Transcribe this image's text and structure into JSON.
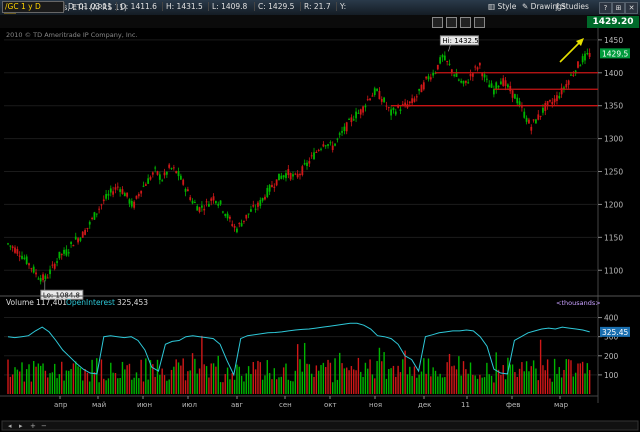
{
  "window": {
    "title": "Gold Futures, ETH (APRS 11)",
    "buttons": {
      "help": "?",
      "pin": "⊞",
      "close": "✕"
    }
  },
  "quote": {
    "symbol": "/GC 1 y D",
    "date": "D: 01.03.11",
    "open": "O: 1411.6",
    "high": "H: 1431.5",
    "low": "L: 1409.8",
    "close": "C: 1429.5",
    "range": "R: 21.7",
    "y": "Y:",
    "last": "1429.20"
  },
  "toolbar": {
    "style": "Style",
    "drawings": "Drawings",
    "studies": "Studies"
  },
  "copyright": "2010 © TD Ameritrade IP Company, Inc.",
  "colors": {
    "up": "#00b400",
    "down": "#d01818",
    "oi": "#2ec8d8",
    "resistance": "#c81414",
    "arrow": "#e6e000",
    "price_tag": "#009a3c",
    "oi_tag": "#1a6fb0"
  },
  "chart_data": {
    "type": "candlestick",
    "price": {
      "yticks": [
        1100,
        1150,
        1200,
        1250,
        1300,
        1350,
        1400,
        1450
      ],
      "ylim": [
        1070,
        1465
      ],
      "last_tag": "1429.5",
      "high_label": "Hi: 1432.5",
      "low_label": "Lo: 1084.8",
      "resistance_levels": [
        1400,
        1375,
        1350
      ],
      "path": [
        [
          0,
          1140
        ],
        [
          6,
          1128
        ],
        [
          12,
          1108
        ],
        [
          16,
          1092
        ],
        [
          20,
          1086
        ],
        [
          24,
          1102
        ],
        [
          28,
          1122
        ],
        [
          32,
          1128
        ],
        [
          36,
          1145
        ],
        [
          40,
          1152
        ],
        [
          44,
          1168
        ],
        [
          48,
          1188
        ],
        [
          52,
          1205
        ],
        [
          56,
          1218
        ],
        [
          60,
          1228
        ],
        [
          64,
          1215
        ],
        [
          68,
          1196
        ],
        [
          72,
          1222
        ],
        [
          76,
          1236
        ],
        [
          80,
          1250
        ],
        [
          84,
          1238
        ],
        [
          88,
          1256
        ],
        [
          92,
          1248
        ],
        [
          96,
          1228
        ],
        [
          100,
          1206
        ],
        [
          104,
          1194
        ],
        [
          108,
          1200
        ],
        [
          112,
          1212
        ],
        [
          116,
          1198
        ],
        [
          120,
          1178
        ],
        [
          124,
          1162
        ],
        [
          128,
          1176
        ],
        [
          132,
          1190
        ],
        [
          136,
          1198
        ],
        [
          140,
          1215
        ],
        [
          144,
          1230
        ],
        [
          148,
          1242
        ],
        [
          152,
          1248
        ],
        [
          156,
          1240
        ],
        [
          160,
          1252
        ],
        [
          164,
          1266
        ],
        [
          168,
          1282
        ],
        [
          172,
          1296
        ],
        [
          176,
          1286
        ],
        [
          180,
          1302
        ],
        [
          184,
          1318
        ],
        [
          188,
          1334
        ],
        [
          192,
          1342
        ],
        [
          196,
          1362
        ],
        [
          200,
          1372
        ],
        [
          204,
          1358
        ],
        [
          208,
          1338
        ],
        [
          212,
          1346
        ],
        [
          216,
          1350
        ],
        [
          220,
          1356
        ],
        [
          224,
          1372
        ],
        [
          228,
          1392
        ],
        [
          232,
          1402
        ],
        [
          236,
          1424
        ],
        [
          240,
          1410
        ],
        [
          244,
          1392
        ],
        [
          248,
          1380
        ],
        [
          252,
          1398
        ],
        [
          256,
          1412
        ],
        [
          260,
          1386
        ],
        [
          264,
          1374
        ],
        [
          268,
          1390
        ],
        [
          272,
          1376
        ],
        [
          276,
          1362
        ],
        [
          280,
          1340
        ],
        [
          284,
          1318
        ],
        [
          288,
          1332
        ],
        [
          292,
          1348
        ],
        [
          296,
          1356
        ],
        [
          300,
          1368
        ],
        [
          304,
          1386
        ],
        [
          308,
          1404
        ],
        [
          312,
          1420
        ],
        [
          316,
          1428
        ]
      ]
    },
    "volume": {
      "label": "Volume",
      "value": "117,401",
      "oi_label": "OpenInterest",
      "oi_value": "325,453",
      "units": "<thousands>",
      "yticks": [
        100,
        200,
        300,
        400
      ],
      "ylim": [
        0,
        450
      ],
      "oi_tag": "325.45",
      "oi": [
        300,
        295,
        300,
        305,
        330,
        350,
        325,
        280,
        230,
        195,
        160,
        130,
        110,
        105,
        300,
        305,
        300,
        295,
        300,
        280,
        230,
        140,
        120,
        260,
        275,
        280,
        300,
        305,
        300,
        295,
        290,
        260,
        175,
        100,
        290,
        305,
        310,
        315,
        320,
        322,
        325,
        330,
        335,
        338,
        340,
        345,
        350,
        355,
        360,
        365,
        370,
        370,
        360,
        340,
        305,
        300,
        290,
        260,
        200,
        180,
        120,
        300,
        310,
        320,
        325,
        330,
        330,
        335,
        330,
        300,
        250,
        130,
        110,
        105,
        280,
        300,
        320,
        330,
        340,
        345,
        340,
        350,
        345,
        340,
        335,
        325
      ]
    },
    "x_ticks": [
      "апр",
      "май",
      "июн",
      "июл",
      "авг",
      "сен",
      "окт",
      "ноя",
      "дек",
      "11",
      "фев",
      "мар"
    ]
  }
}
